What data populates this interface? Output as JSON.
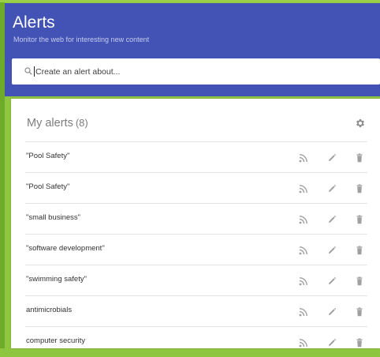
{
  "header": {
    "title": "Alerts",
    "subtitle": "Monitor the web for interesting new content",
    "bg_color": "#4353b5"
  },
  "search": {
    "placeholder": "Create an alert about...",
    "value": "",
    "icon": "search-icon"
  },
  "alerts_card": {
    "title": "My alerts",
    "count": "(8)",
    "settings_icon": "gear-icon",
    "items": [
      {
        "label": "\"Pool Safety\""
      },
      {
        "label": "\"Pool Safety\""
      },
      {
        "label": "\"small business\""
      },
      {
        "label": "\"software development\""
      },
      {
        "label": "\"swimming safety\""
      },
      {
        "label": "antimicrobials"
      },
      {
        "label": "computer security"
      }
    ],
    "row_icons": [
      "rss-icon",
      "pencil-icon",
      "trash-icon"
    ]
  },
  "colors": {
    "page_background": "#8fc640",
    "icon_gray": "#9e9e9e"
  }
}
